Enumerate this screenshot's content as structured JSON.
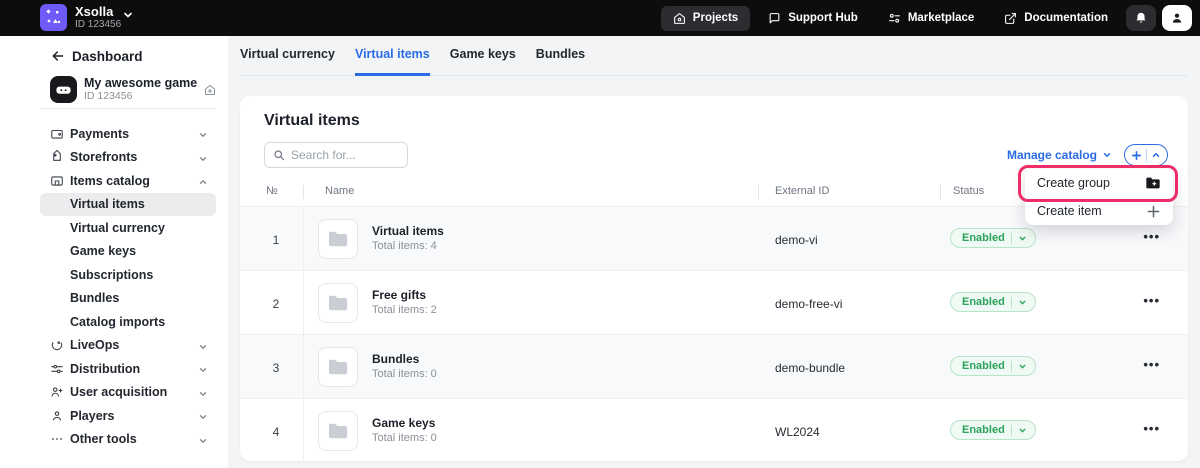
{
  "topbar": {
    "brand_name": "Xsolla",
    "brand_id": "ID 123456",
    "nav": [
      {
        "label": "Projects",
        "icon": "home-icon"
      },
      {
        "label": "Support Hub",
        "icon": "chat-icon"
      },
      {
        "label": "Marketplace",
        "icon": "marketplace-icon"
      },
      {
        "label": "Documentation",
        "icon": "external-link-icon"
      }
    ]
  },
  "sidebar": {
    "back_label": "Dashboard",
    "project": {
      "name": "My awesome game",
      "id": "ID 123456"
    },
    "items": [
      {
        "label": "Payments"
      },
      {
        "label": "Storefronts"
      },
      {
        "label": "Items catalog"
      },
      {
        "label": "Virtual items",
        "selected": true
      },
      {
        "label": "Virtual currency"
      },
      {
        "label": "Game keys"
      },
      {
        "label": "Subscriptions"
      },
      {
        "label": "Bundles"
      },
      {
        "label": "Catalog imports"
      },
      {
        "label": "LiveOps"
      },
      {
        "label": "Distribution"
      },
      {
        "label": "User acquisition"
      },
      {
        "label": "Players"
      },
      {
        "label": "Other tools"
      }
    ]
  },
  "tabs": [
    {
      "label": "Virtual currency"
    },
    {
      "label": "Virtual items",
      "active": true
    },
    {
      "label": "Game keys"
    },
    {
      "label": "Bundles"
    }
  ],
  "main": {
    "title": "Virtual items",
    "search_placeholder": "Search for...",
    "manage_catalog_label": "Manage catalog",
    "menu_items": [
      {
        "label": "Create group",
        "icon": "folder-plus-icon",
        "highlighted": true
      },
      {
        "label": "Create item",
        "icon": "plus-icon"
      }
    ],
    "table": {
      "columns": [
        "№",
        "Name",
        "External ID",
        "Status"
      ],
      "rows": [
        {
          "num": "1",
          "name": "Virtual items",
          "subtitle": "Total items: 4",
          "external_id": "demo-vi",
          "status": "Enabled"
        },
        {
          "num": "2",
          "name": "Free gifts",
          "subtitle": "Total items: 2",
          "external_id": "demo-free-vi",
          "status": "Enabled"
        },
        {
          "num": "3",
          "name": "Bundles",
          "subtitle": "Total items: 0",
          "external_id": "demo-bundle",
          "status": "Enabled"
        },
        {
          "num": "4",
          "name": "Game keys",
          "subtitle": "Total items: 0",
          "external_id": "WL2024",
          "status": "Enabled"
        }
      ]
    }
  },
  "colors": {
    "accent_blue": "#2b6be4",
    "brand_purple": "#6e5af6",
    "status_green": "#2aa25c",
    "annotation_pink": "#ed2c68",
    "topbar_black": "#0d0d0e"
  }
}
